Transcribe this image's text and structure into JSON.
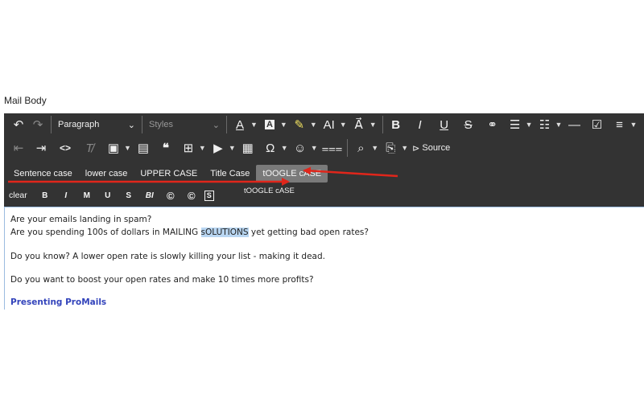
{
  "mail_body_label": "Mail Body",
  "toolbar": {
    "paragraph_format": "Paragraph",
    "styles_placeholder": "Styles",
    "source_label": "Source"
  },
  "case_buttons": [
    "Sentence case",
    "lower case",
    "UPPER CASE",
    "Title Case",
    "tOOGLE cASE"
  ],
  "tooltip": "tOOGLE cASE",
  "format_buttons": [
    "clear",
    "B",
    "I",
    "M",
    "U",
    "S",
    "BI",
    "©",
    "©",
    "S"
  ],
  "content": {
    "line1": "Are your emails landing in spam?",
    "line2_before": "Are you spending 100s of dollars in MAILING ",
    "line2_selected": "sOLUTIONS",
    "line2_after": " yet getting bad open rates?",
    "line3": "Do you know? A lower open rate is slowly killing your list - making it dead.",
    "line4": "Do you want to boost your open rates and make 10 times more profits?",
    "line5": "Presenting ProMails"
  },
  "colors": {
    "toolbar_bg": "#333333",
    "active_button": "#7a7a7a",
    "selection": "#b9d6f2",
    "link": "#3344bb",
    "annotation_arrow": "#e0261b"
  }
}
